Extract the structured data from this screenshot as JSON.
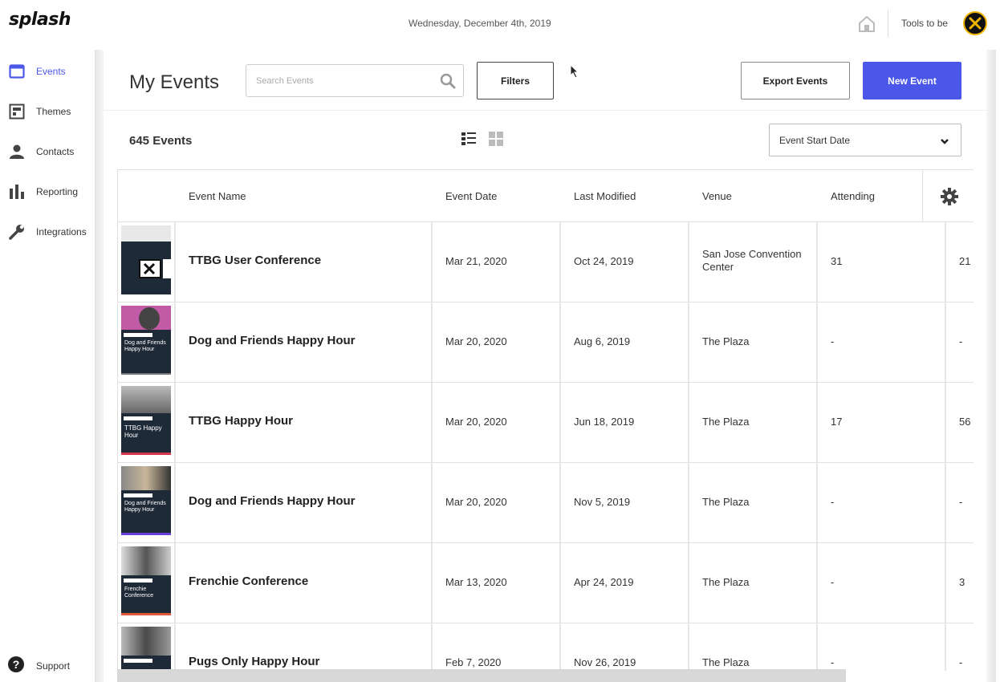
{
  "app": {
    "logo": "splash",
    "date": "Wednesday, December 4th, 2019",
    "org_name": "Tools to be",
    "accent": "#4a57e8"
  },
  "sidebar": {
    "items": [
      {
        "label": "Events",
        "icon": "calendar-icon",
        "active": true
      },
      {
        "label": "Themes",
        "icon": "themes-icon",
        "active": false
      },
      {
        "label": "Contacts",
        "icon": "person-icon",
        "active": false
      },
      {
        "label": "Reporting",
        "icon": "bar-chart-icon",
        "active": false
      },
      {
        "label": "Integrations",
        "icon": "wrench-icon",
        "active": false
      }
    ],
    "support": "Support"
  },
  "header": {
    "title": "My Events",
    "search_placeholder": "Search Events",
    "filters_label": "Filters",
    "export_label": "Export Events",
    "new_label": "New Event"
  },
  "toolbar": {
    "count": "645 Events",
    "sort_label": "Event Start Date"
  },
  "table": {
    "columns": [
      "Event Name",
      "Event Date",
      "Last Modified",
      "Venue",
      "Attending"
    ],
    "rows": [
      {
        "name": "TTBG User Conference",
        "event_date": "Mar 21, 2020",
        "modified": "Oct 24, 2019",
        "venue": "San Jose Convention Center",
        "attending": "31",
        "extra": "21",
        "thumb_text": ""
      },
      {
        "name": "Dog and Friends Happy Hour",
        "event_date": "Mar 20, 2020",
        "modified": "Aug 6, 2019",
        "venue": "The Plaza",
        "attending": "-",
        "extra": "-",
        "thumb_text": "Dog and Friends Happy Hour"
      },
      {
        "name": "TTBG Happy Hour",
        "event_date": "Mar 20, 2020",
        "modified": "Jun 18, 2019",
        "venue": "The Plaza",
        "attending": "17",
        "extra": "56",
        "thumb_text": "TTBG Happy Hour"
      },
      {
        "name": "Dog and Friends Happy Hour",
        "event_date": "Mar 20, 2020",
        "modified": "Nov 5, 2019",
        "venue": "The Plaza",
        "attending": "-",
        "extra": "-",
        "thumb_text": "Dog and Friends Happy Hour"
      },
      {
        "name": "Frenchie Conference",
        "event_date": "Mar 13, 2020",
        "modified": "Apr 24, 2019",
        "venue": "The Plaza",
        "attending": "-",
        "extra": "3",
        "thumb_text": "Frenchie Conference"
      },
      {
        "name": "Pugs Only Happy Hour",
        "event_date": "Feb 7, 2020",
        "modified": "Nov 26, 2019",
        "venue": "The Plaza",
        "attending": "-",
        "extra": "-",
        "thumb_text": ""
      }
    ]
  }
}
